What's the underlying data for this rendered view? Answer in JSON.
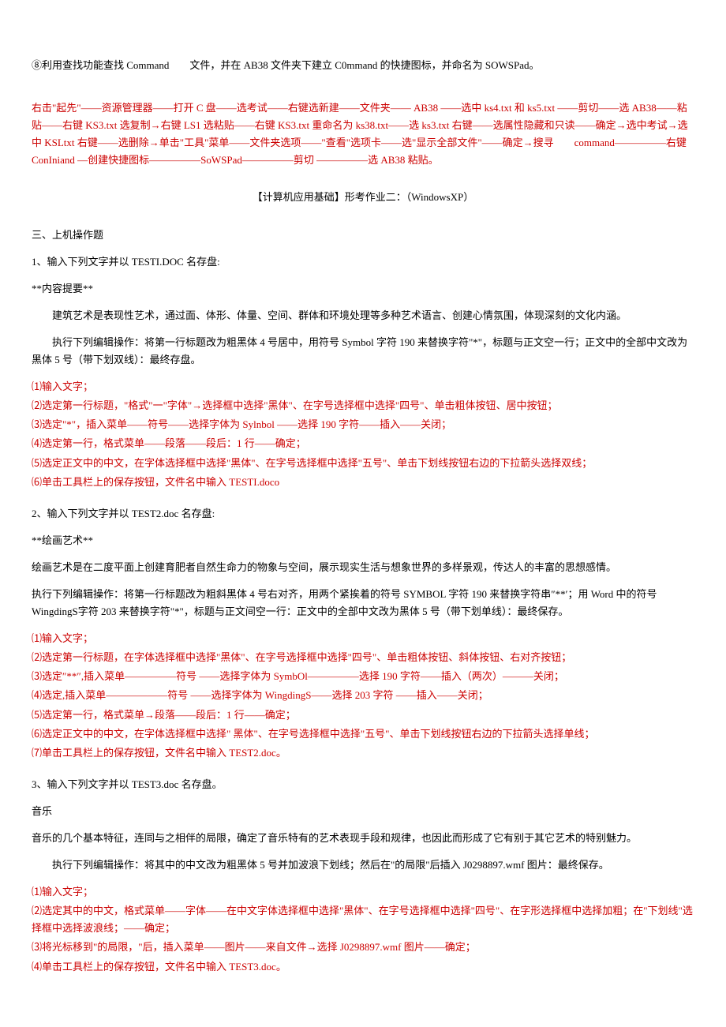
{
  "q8": {
    "line1": "⑧利用查找功能查找 Command　　文件，并在 AB38 文件夹下建立 C0mmand 的快捷图标，并命名为 SOWSPad。",
    "ans1": "右击\"起先\"――资源管理器――打开 C 盘――选考试――右键选新建――文件夹―― AB38 ――选中 ks4.txt 和 ks5.txt ――剪切――选 AB38――粘贴――右键 KS3.txt 选复制→右键 LS1 选粘贴――右键 KS3.txt 重命名为 ks38.txt――选 ks3.txt 右键――选属性隐藏和只读――确定→选中考试→选中 KSLtxt 右键——选删除→单击\"工具\"菜单――文件夹选项――\"查看\"选项卡――选\"显示全部文件\"――确定→搜寻　　command―――――右键 ConIniand —创建快捷图标―――――SoWSPad―――――剪切 ―――――选 AB38 粘贴。"
  },
  "title": "【计算机应用基础】形考作业二：（WindowsXP）",
  "sec3": "三、上机操作题",
  "q1": {
    "head": "1、输入下列文字并以 TESTI.DOC 名存盘:",
    "sub1": "**内容提要**",
    "text1": "建筑艺术是表现性艺术，通过面、体形、体量、空间、群体和环境处理等多种艺术语言、创建心情氛围，体现深刻的文化内涵。",
    "text2": "执行下列编辑操作：将第一行标题改为粗黑体 4 号居中，用符号 Symbol 字符 190 来替换字符\"*\"，标题与正文空一行；正文中的全部中文改为黑体 5 号（带下划双线）：最终存盘。",
    "a1": "⑴输入文字；",
    "a2": "⑵选定第一行标题，\"格式\"一\"字体\"→选择框中选择\"黑体\"、在字号选择框中选择\"四号\"、单击粗体按钮、居中按钮；",
    "a3": "⑶选定\"*\"，插入菜单――符号――选择字体为 Sylnbol ――选择 190 字符――插入――关闭；",
    "a4": "⑷选定第一行，格式菜单――段落――段后：1 行――确定；",
    "a5": "⑸选定正文中的中文，在字体选择框中选择\"黑体\"、在字号选择框中选择\"五号\"、单击下划线按钮右边的下拉箭头选择双线；",
    "a6": "⑹单击工具栏上的保存按钮，文件名中输入 TESTI.doco"
  },
  "q2": {
    "head": "2、输入下列文字并以 TEST2.doc 名存盘:",
    "sub1": "**绘画艺术**",
    "text1": "绘画艺术是在二度平面上创建育肥者自然生命力的物象与空间，展示现实生活与想象世界的多样景观，传达人的丰富的思想感情。",
    "text2": "执行下列编辑操作：将第一行标题改为粗斜黑体 4 号右对齐，用两个紧挨着的符号 SYMBOL 字符 190 来替换字符串″**′；用 Word 中的符号 WingdingS字符 203 来替换字符\"*\"，标题与正文间空一行：正文中的全部中文改为黑体 5 号（带下划单线）：最终保存。",
    "a1": "⑴输入文字；",
    "a2": "⑵选定第一行标题，在字体选择框中选择\"黑体\"、在字号选择框中选择\"四号\"、单击粗体按钮、斜体按钮、右对齐按钮；",
    "a3": "⑶选定″**″,插入菜单―――――符号 ――选择字体为 SymbOl―――――选择 190 字符――插入（两次）―――关闭；",
    "a4": "⑷选定,插入菜单――――――符号 ――选择字体为 WingdingS――选择 203 字符 ――插入――关闭；",
    "a5": "⑸选定第一行，格式菜单→段落――段后：1 行――确定；",
    "a6": "⑹选定正文中的中文，在字体选择框中选择\" 黑体\"、在字号选择框中选择\"五号\"、单击下划线按钮右边的下拉箭头选择单线；",
    "a7": "⑺单击工具栏上的保存按钮，文件名中输入 TEST2.doc。"
  },
  "q3": {
    "head": "3、输入下列文字并以 TEST3.doc 名存盘。",
    "sub1": "音乐",
    "text1": "音乐的几个基本特征，连同与之相伴的局限，确定了音乐特有的艺术表现手段和规律，也因此而形成了它有别于其它艺术的特别魅力。",
    "text2": "执行下列编辑操作：将其中的中文改为粗黑体 5 号并加波浪下划线；然后在\"的局限\"后插入 J0298897.wmf 图片：最终保存。",
    "a1": "⑴输入文字；",
    "a2": "⑵选定其中的中文，格式菜单――字体――在中文字体选择框中选择\"黑体\"、在字号选择框中选择\"四号\"、在字形选择框中选择加粗；在\"下划线\"选择框中选择波浪线；――确定；",
    "a3": "⑶将光标移到\"的局限，\"后，插入菜单――图片――来自文件→选择 J0298897.wmf 图片――确定；",
    "a4": "⑷单击工具栏上的保存按钮，文件名中输入 TEST3.doc。"
  }
}
